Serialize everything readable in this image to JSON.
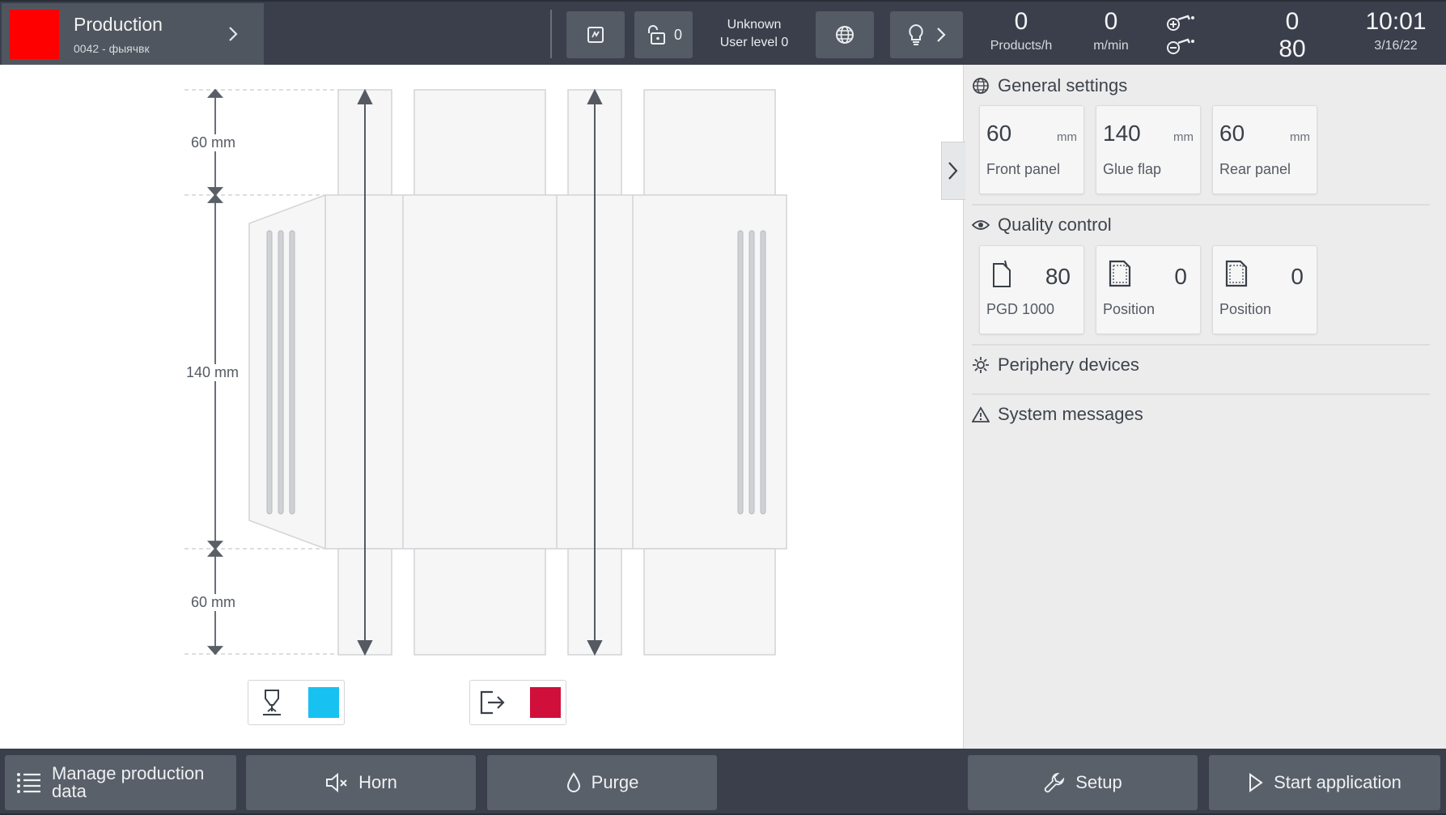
{
  "header": {
    "production_title": "Production",
    "production_sub": "0042 - фыячвк",
    "status_color": "#ff0000",
    "lock_count": "0",
    "user_name": "Unknown",
    "user_level": "User level 0",
    "products_value": "0",
    "products_unit": "Products/h",
    "speed_value": "0",
    "speed_unit": "m/min",
    "counter_top": "0",
    "counter_bottom": "80",
    "time": "10:01",
    "date": "3/16/22"
  },
  "drawing": {
    "top_dim": "60 mm",
    "middle_dim": "140 mm",
    "bottom_dim": "60 mm",
    "swatch_cyan": "#17c1f0",
    "swatch_red": "#d0103a"
  },
  "panel": {
    "general_settings_title": "General settings",
    "general_cards": [
      {
        "value": "60",
        "unit": "mm",
        "label": "Front panel"
      },
      {
        "value": "140",
        "unit": "mm",
        "label": "Glue flap"
      },
      {
        "value": "60",
        "unit": "mm",
        "label": "Rear panel"
      }
    ],
    "quality_title": "Quality control",
    "quality_cards": [
      {
        "value": "80",
        "label": "PGD 1000"
      },
      {
        "value": "0",
        "label": "Position"
      },
      {
        "value": "0",
        "label": "Position"
      }
    ],
    "periphery_title": "Periphery devices",
    "messages_title": "System messages"
  },
  "footer": {
    "manage_line1": "Manage production",
    "manage_line2": "data",
    "horn": "Horn",
    "purge": "Purge",
    "setup": "Setup",
    "start": "Start application"
  }
}
